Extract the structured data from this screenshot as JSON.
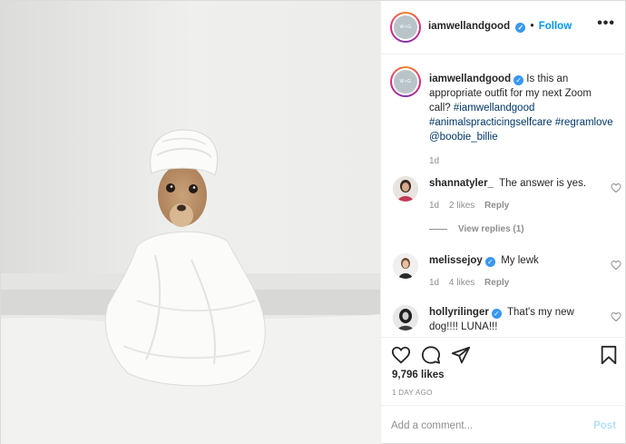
{
  "colors": {
    "accent": "#0095f6",
    "verified": "#3897f0",
    "muted": "#8e8e8e",
    "post_disabled": "#b2dffc"
  },
  "photo": {
    "alt": "chihuahua wrapped in white towel"
  },
  "header": {
    "username": "iamwellandgood",
    "separator": "•",
    "follow_label": "Follow",
    "more_label": "•••",
    "verified_icon": "verified-badge-icon"
  },
  "caption": {
    "username": "iamwellandgood",
    "text": "Is this an appropriate outfit for my next Zoom call?",
    "tags": [
      "#iamwellandgood",
      "#animalspracticingselfcare",
      "#regramlove",
      "@boobie_billie"
    ],
    "age": "1d"
  },
  "comments": [
    {
      "username": "shannatyler_",
      "verified": false,
      "text": "The answer is yes.",
      "age": "1d",
      "likes": "2 likes",
      "reply": "Reply"
    },
    {
      "username": "melissejoy",
      "verified": true,
      "text": "My lewk",
      "age": "1d",
      "likes": "4 likes",
      "reply": "Reply"
    },
    {
      "username": "hollyrilinger",
      "verified": true,
      "text": "That's my new dog!!!! LUNA!!!"
    }
  ],
  "view_replies": "View replies (1)",
  "actions": {
    "icons": [
      "heart-icon",
      "comment-icon",
      "share-icon",
      "bookmark-icon"
    ],
    "likes": "9,796 likes",
    "time": "1 DAY AGO"
  },
  "add_comment": {
    "placeholder": "Add a comment...",
    "post_label": "Post"
  }
}
